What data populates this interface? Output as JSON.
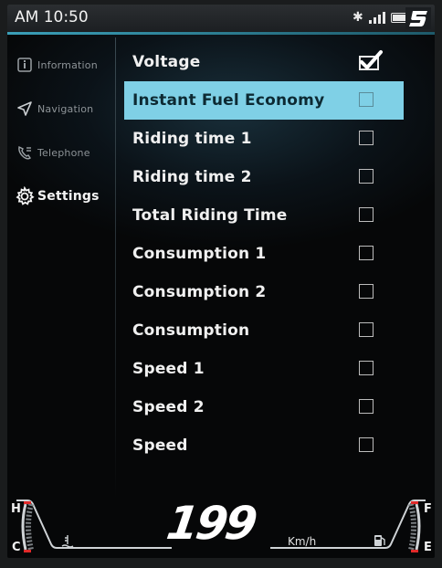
{
  "status": {
    "time": "AM 10:50",
    "icons": [
      "bluetooth-icon",
      "signal-icon",
      "battery-icon",
      "brand-logo"
    ]
  },
  "sidebar": {
    "items": [
      {
        "label": "Information",
        "icon": "info-icon",
        "active": false
      },
      {
        "label": "Navigation",
        "icon": "navigation-arrow-icon",
        "active": false
      },
      {
        "label": "Telephone",
        "icon": "phone-icon",
        "active": false
      },
      {
        "label": "Settings",
        "icon": "gear-icon",
        "active": true
      }
    ]
  },
  "settings_list": {
    "items": [
      {
        "label": "Voltage",
        "checked": true,
        "selected": false
      },
      {
        "label": "Instant Fuel Economy",
        "checked": false,
        "selected": true
      },
      {
        "label": "Riding time 1",
        "checked": false,
        "selected": false
      },
      {
        "label": "Riding time 2",
        "checked": false,
        "selected": false
      },
      {
        "label": "Total Riding Time",
        "checked": false,
        "selected": false
      },
      {
        "label": "Consumption 1",
        "checked": false,
        "selected": false
      },
      {
        "label": "Consumption 2",
        "checked": false,
        "selected": false
      },
      {
        "label": "Consumption",
        "checked": false,
        "selected": false
      },
      {
        "label": "Speed 1",
        "checked": false,
        "selected": false
      },
      {
        "label": "Speed 2",
        "checked": false,
        "selected": false
      },
      {
        "label": "Speed",
        "checked": false,
        "selected": false
      }
    ]
  },
  "gauges": {
    "temp_high_label": "H",
    "temp_low_label": "C",
    "fuel_full_label": "F",
    "fuel_empty_label": "E",
    "speed_value": "199",
    "speed_unit": "Km/h",
    "accent_color": "#e02a2a"
  },
  "colors": {
    "highlight": "#7fd0e6",
    "accent": "#3a9fb8"
  }
}
